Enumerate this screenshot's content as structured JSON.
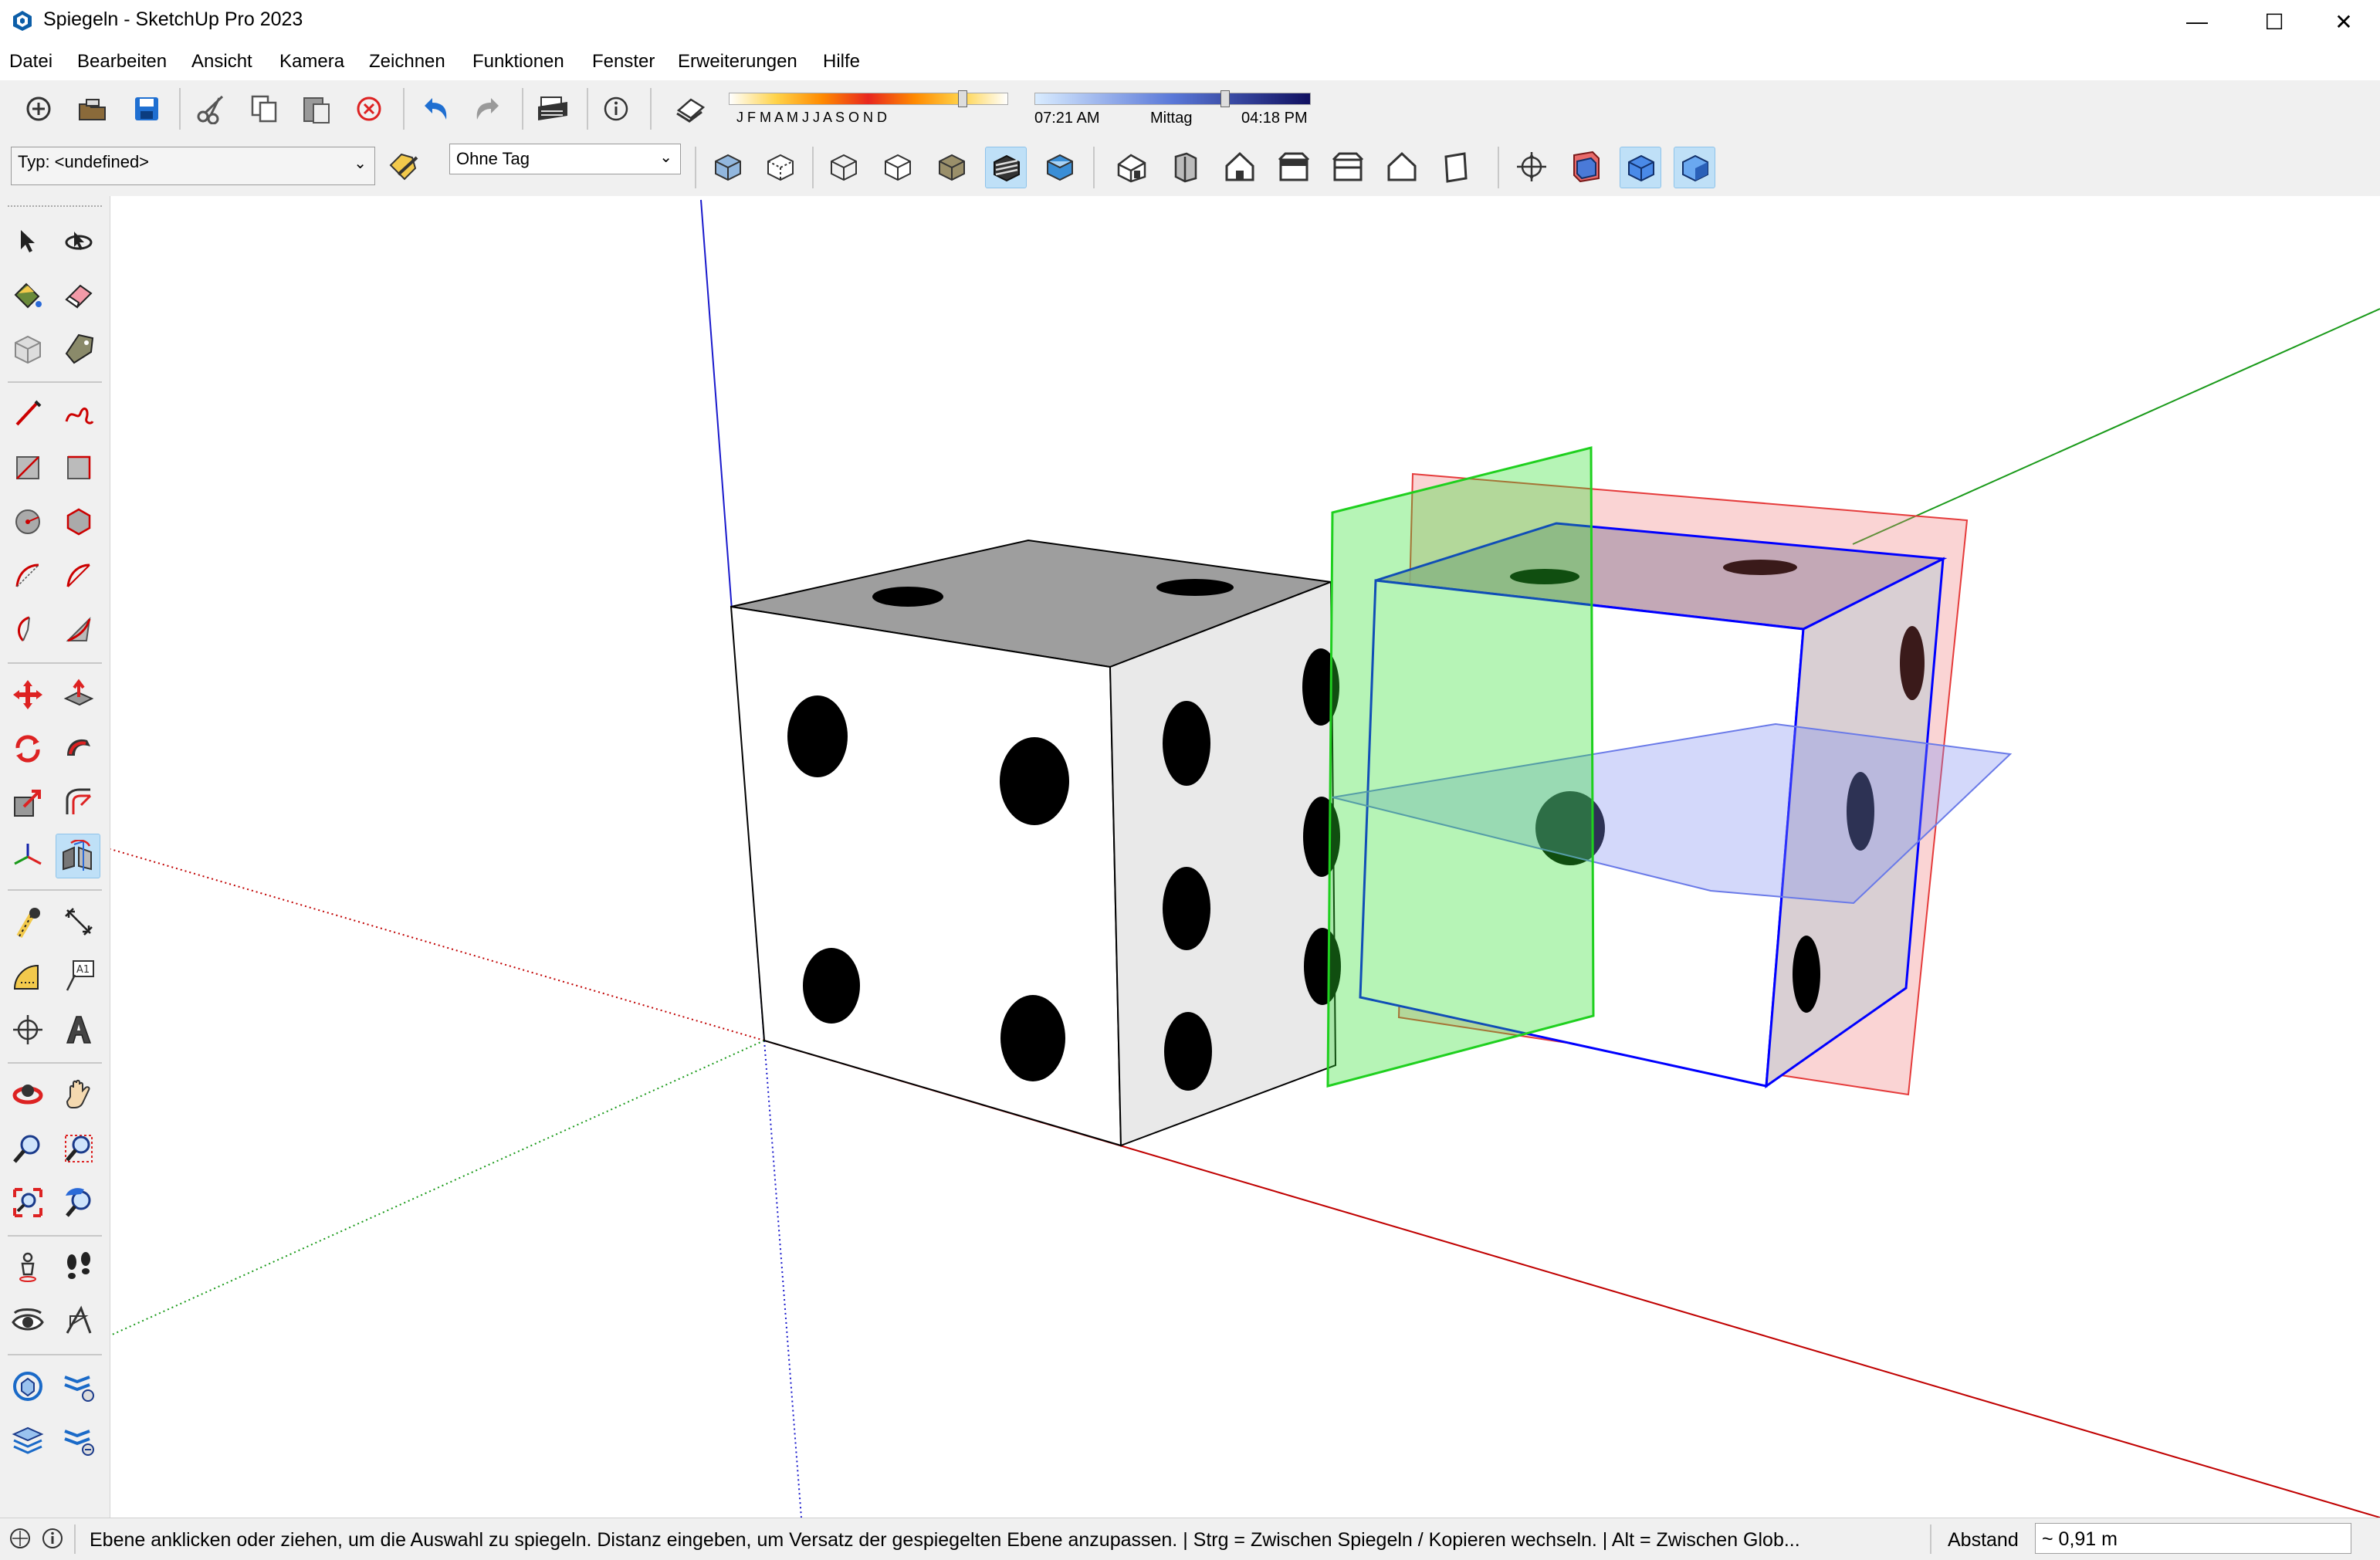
{
  "window": {
    "title": "Spiegeln - SketchUp Pro 2023",
    "minimize_glyph": "—",
    "maximize_glyph": "☐",
    "close_glyph": "✕"
  },
  "menu": [
    "Datei",
    "Bearbeiten",
    "Ansicht",
    "Kamera",
    "Zeichnen",
    "Funktionen",
    "Fenster",
    "Erweiterungen",
    "Hilfe"
  ],
  "shadows": {
    "months": "J F M A M J J A S O N D",
    "time_start": "07:21 AM",
    "time_mid": "Mittag",
    "time_end": "04:18 PM",
    "month_slider_position": 0.85,
    "time_slider_position": 0.68
  },
  "entity_info": {
    "type_label": "Typ: <undefined>",
    "tag_select": "Ohne Tag"
  },
  "status": {
    "hint": "Ebene anklicken oder ziehen, um die Auswahl zu spiegeln. Distanz eingeben, um Versatz der gespiegelten Ebene anzupassen. | Strg = Zwischen Spiegeln / Kopieren wechseln. | Alt = Zwischen Glob...",
    "vcb_label": "Abstand",
    "vcb_value": "~ 0,91 m"
  },
  "colors": {
    "axis_red": "#c00000",
    "axis_green": "#1a9a1a",
    "axis_blue": "#1a1acc",
    "plane_green": "#2ee02e",
    "plane_red": "#f07878",
    "plane_blue": "#8090f0",
    "selection_blue": "#0000ff",
    "active_tool": "#bfe0f7"
  },
  "icons": {
    "toolbar": [
      "new-icon",
      "open-icon",
      "save-icon",
      "cut-icon",
      "copy-icon",
      "paste-icon",
      "erase-icon",
      "undo-icon",
      "redo-icon",
      "print-icon",
      "model-info-icon",
      "shadows-toggle-icon"
    ],
    "styles": [
      "xray-icon",
      "back-edges-icon",
      "wireframe-icon",
      "hidden-line-icon",
      "shaded-icon",
      "shaded-with-textures-icon",
      "monochrome-icon"
    ],
    "views": [
      "iso-view-icon",
      "top-view-icon",
      "front-view-icon",
      "right-view-icon",
      "back-view-icon",
      "left-view-icon",
      "bottom-view-icon"
    ],
    "sections": [
      "section-plane-icon",
      "display-section-planes-icon",
      "display-section-cuts-icon",
      "display-section-fill-icon"
    ],
    "tools": [
      "select-icon",
      "orbit-icon",
      "paint-bucket-icon",
      "eraser-icon",
      "make-component-icon",
      "tag-icon",
      "line-icon",
      "freehand-icon",
      "rectangle-icon",
      "rotated-rectangle-icon",
      "circle-icon",
      "polygon-icon",
      "arc-icon",
      "two-point-arc-icon",
      "pie-icon",
      "three-point-arc-icon",
      "move-icon",
      "push-pull-icon",
      "rotate-icon",
      "follow-me-icon",
      "scale-icon",
      "offset-icon",
      "axes-icon",
      "flip-icon",
      "tape-measure-icon",
      "dimension-icon",
      "protractor-icon",
      "text-icon",
      "section-plane-tool-icon",
      "three-d-text-icon",
      "orbit-tool-icon",
      "pan-icon",
      "zoom-icon",
      "zoom-window-icon",
      "zoom-extents-icon",
      "previous-view-icon",
      "position-camera-icon",
      "walk-icon",
      "look-around-icon",
      "match-photo-icon",
      "solid-tools-icon",
      "outer-shell-icon",
      "stack-icon",
      "intersect-icon"
    ]
  }
}
